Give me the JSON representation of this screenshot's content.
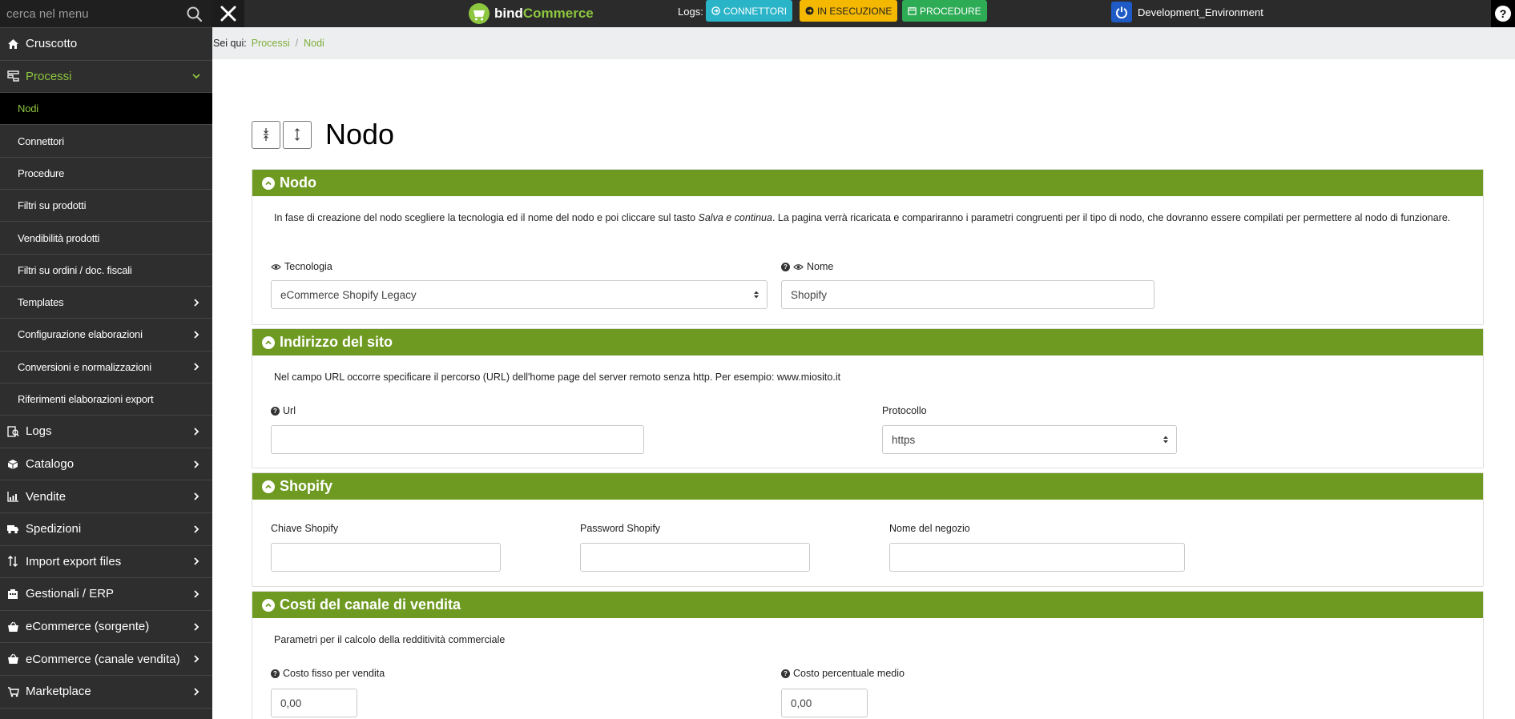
{
  "sidebar": {
    "search_placeholder": "cerca nel menu",
    "items": [
      {
        "label": "Cruscotto",
        "icon": "home-icon"
      },
      {
        "label": "Processi",
        "icon": "processes-icon"
      },
      {
        "label": "Logs",
        "icon": "logs-icon"
      },
      {
        "label": "Catalogo",
        "icon": "cube-icon"
      },
      {
        "label": "Vendite",
        "icon": "chart-icon"
      },
      {
        "label": "Spedizioni",
        "icon": "truck-icon"
      },
      {
        "label": "Import export files",
        "icon": "sort-icon"
      },
      {
        "label": "Gestionali / ERP",
        "icon": "erp-icon"
      },
      {
        "label": "eCommerce (sorgente)",
        "icon": "basket-icon"
      },
      {
        "label": "eCommerce (canale vendita)",
        "icon": "basket-icon"
      },
      {
        "label": "Marketplace",
        "icon": "cart-icon"
      }
    ],
    "subitems": [
      {
        "label": "Nodi"
      },
      {
        "label": "Connettori"
      },
      {
        "label": "Procedure"
      },
      {
        "label": "Filtri su prodotti"
      },
      {
        "label": "Vendibilità prodotti"
      },
      {
        "label": "Filtri su ordini / doc. fiscali"
      },
      {
        "label": "Templates"
      },
      {
        "label": "Configurazione elaborazioni"
      },
      {
        "label": "Conversioni e normalizzazioni"
      },
      {
        "label": "Riferimenti elaborazioni export"
      }
    ]
  },
  "topbar": {
    "logo_part1": "bind",
    "logo_part2": "Commerce",
    "logs_label": "Logs:",
    "btn_connettori": "CONNETTORI",
    "btn_esecuzione": "IN ESECUZIONE",
    "btn_procedure": "PROCEDURE",
    "environment": "Development_Environment"
  },
  "breadcrumb": {
    "label": "Sei qui:",
    "items": [
      "Processi",
      "Nodi"
    ],
    "separator": "/"
  },
  "page": {
    "title": "Nodo"
  },
  "panels": {
    "nodo": {
      "title": "Nodo",
      "desc_before": "In fase di creazione del nodo scegliere la tecnologia ed il nome del nodo e poi cliccare sul tasto ",
      "desc_italic": "Salva e continua",
      "desc_after": ". La pagina verrà ricaricata e compariranno i parametri congruenti per il tipo di nodo, che dovranno essere compilati per permettere al nodo di funzionare.",
      "tecnologia_label": "Tecnologia",
      "tecnologia_value": "eCommerce Shopify Legacy",
      "nome_label": "Nome",
      "nome_value": "Shopify"
    },
    "indirizzo": {
      "title": "Indirizzo del sito",
      "desc": "Nel campo URL occorre specificare il percorso (URL) dell'home page del server remoto senza http. Per esempio: www.miosito.it",
      "url_label": "Url",
      "url_value": "",
      "protocollo_label": "Protocollo",
      "protocollo_value": "https"
    },
    "shopify": {
      "title": "Shopify",
      "chiave_label": "Chiave Shopify",
      "password_label": "Password Shopify",
      "negozio_label": "Nome del negozio"
    },
    "costi": {
      "title": "Costi del canale di vendita",
      "desc": "Parametri per il calcolo della redditività commerciale",
      "fisso_label": "Costo fisso per vendita",
      "fisso_value": "0,00",
      "percentuale_label": "Costo percentuale medio",
      "percentuale_value": "0,00"
    }
  },
  "colors": {
    "accent_green": "#6f9a22",
    "menu_active": "#8dc63f",
    "connettori": "#2ab4c8",
    "esecuzione": "#f5b800",
    "procedure": "#2dab55"
  }
}
